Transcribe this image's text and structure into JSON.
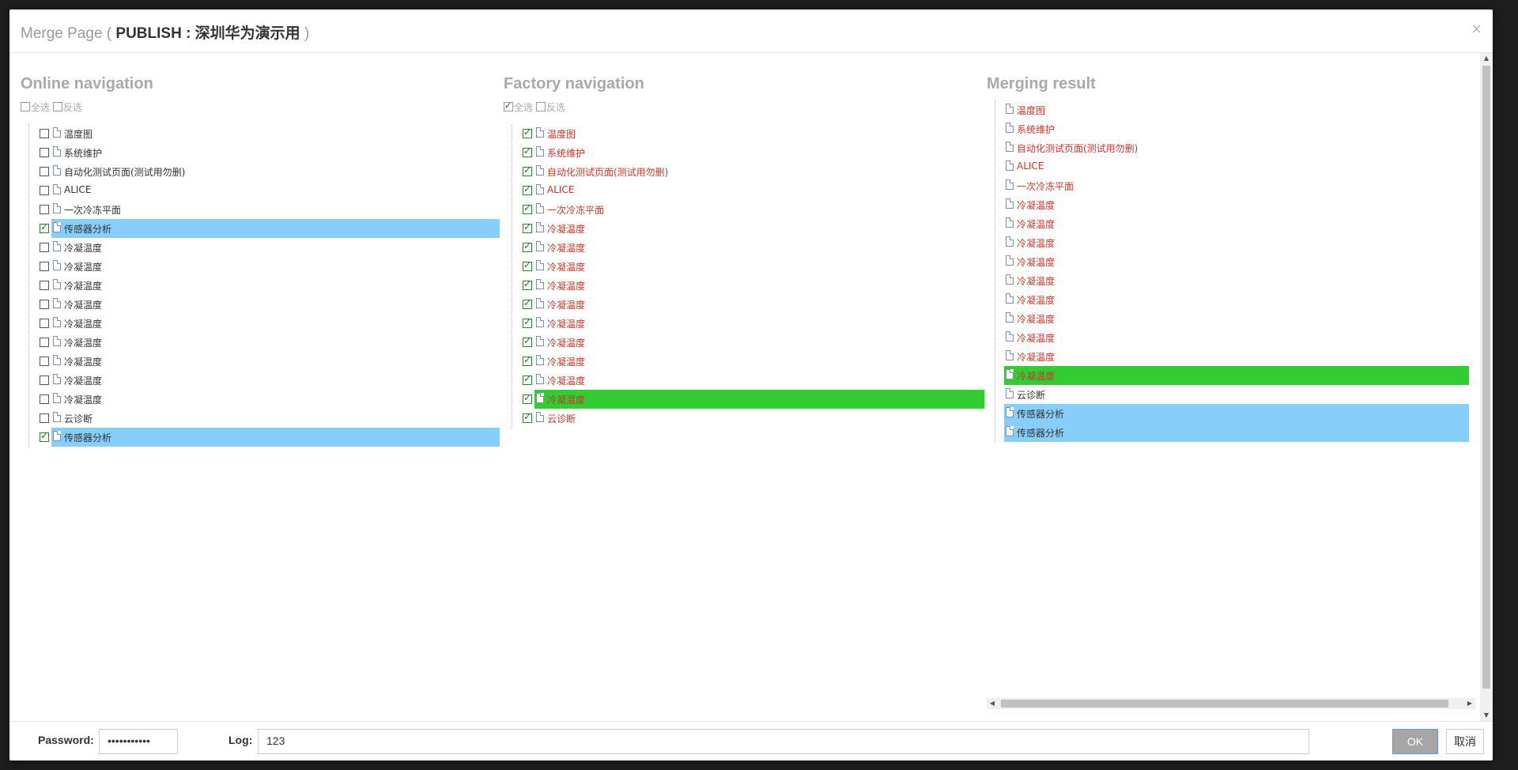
{
  "dialog": {
    "title_prefix": "Merge Page ( ",
    "title_bold": "PUBLISH : 深圳华为演示用",
    "title_suffix": " )",
    "close": "×"
  },
  "online": {
    "heading": "Online navigation",
    "select_all": "全选",
    "invert": "反选",
    "select_all_checked": false,
    "invert_checked": false,
    "items": [
      {
        "label": "温度图",
        "checked": false,
        "highlight": ""
      },
      {
        "label": "系统维护",
        "checked": false,
        "highlight": ""
      },
      {
        "label": "自动化测试页面(测试用勿删)",
        "checked": false,
        "highlight": ""
      },
      {
        "label": "ALICE",
        "checked": false,
        "highlight": ""
      },
      {
        "label": "一次冷冻平面",
        "checked": false,
        "highlight": ""
      },
      {
        "label": "传感器分析",
        "checked": true,
        "highlight": "blue"
      },
      {
        "label": "冷凝温度",
        "checked": false,
        "highlight": ""
      },
      {
        "label": "冷凝温度",
        "checked": false,
        "highlight": ""
      },
      {
        "label": "冷凝温度",
        "checked": false,
        "highlight": ""
      },
      {
        "label": "冷凝温度",
        "checked": false,
        "highlight": ""
      },
      {
        "label": "冷凝温度",
        "checked": false,
        "highlight": ""
      },
      {
        "label": "冷凝温度",
        "checked": false,
        "highlight": ""
      },
      {
        "label": "冷凝温度",
        "checked": false,
        "highlight": ""
      },
      {
        "label": "冷凝温度",
        "checked": false,
        "highlight": ""
      },
      {
        "label": "冷凝温度",
        "checked": false,
        "highlight": ""
      },
      {
        "label": "云诊断",
        "checked": false,
        "highlight": ""
      },
      {
        "label": "传感器分析",
        "checked": true,
        "highlight": "blue"
      }
    ]
  },
  "factory": {
    "heading": "Factory navigation",
    "select_all": "全选",
    "invert": "反选",
    "select_all_checked": true,
    "invert_checked": false,
    "items": [
      {
        "label": "温度图",
        "checked": true,
        "highlight": ""
      },
      {
        "label": "系统维护",
        "checked": true,
        "highlight": ""
      },
      {
        "label": "自动化测试页面(测试用勿删)",
        "checked": true,
        "highlight": ""
      },
      {
        "label": "ALICE",
        "checked": true,
        "highlight": ""
      },
      {
        "label": "一次冷冻平面",
        "checked": true,
        "highlight": ""
      },
      {
        "label": "冷凝温度",
        "checked": true,
        "highlight": ""
      },
      {
        "label": "冷凝温度",
        "checked": true,
        "highlight": ""
      },
      {
        "label": "冷凝温度",
        "checked": true,
        "highlight": ""
      },
      {
        "label": "冷凝温度",
        "checked": true,
        "highlight": ""
      },
      {
        "label": "冷凝温度",
        "checked": true,
        "highlight": ""
      },
      {
        "label": "冷凝温度",
        "checked": true,
        "highlight": ""
      },
      {
        "label": "冷凝温度",
        "checked": true,
        "highlight": ""
      },
      {
        "label": "冷凝温度",
        "checked": true,
        "highlight": ""
      },
      {
        "label": "冷凝温度",
        "checked": true,
        "highlight": ""
      },
      {
        "label": "冷凝温度",
        "checked": true,
        "highlight": "green"
      },
      {
        "label": "云诊断",
        "checked": true,
        "highlight": ""
      }
    ]
  },
  "result": {
    "heading": "Merging result",
    "items": [
      {
        "label": "温度图",
        "highlight": ""
      },
      {
        "label": "系统维护",
        "highlight": ""
      },
      {
        "label": "自动化测试页面(测试用勿删)",
        "highlight": ""
      },
      {
        "label": "ALICE",
        "highlight": ""
      },
      {
        "label": "一次冷冻平面",
        "highlight": ""
      },
      {
        "label": "冷凝温度",
        "highlight": ""
      },
      {
        "label": "冷凝温度",
        "highlight": ""
      },
      {
        "label": "冷凝温度",
        "highlight": ""
      },
      {
        "label": "冷凝温度",
        "highlight": ""
      },
      {
        "label": "冷凝温度",
        "highlight": ""
      },
      {
        "label": "冷凝温度",
        "highlight": ""
      },
      {
        "label": "冷凝温度",
        "highlight": ""
      },
      {
        "label": "冷凝温度",
        "highlight": ""
      },
      {
        "label": "冷凝温度",
        "highlight": ""
      },
      {
        "label": "冷凝温度",
        "highlight": "green"
      },
      {
        "label": "云诊断",
        "highlight": ""
      },
      {
        "label": "传感器分析",
        "highlight": "blue"
      },
      {
        "label": "传感器分析",
        "highlight": "blue"
      }
    ]
  },
  "footer": {
    "password_label": "Password:",
    "password_value": "•••••••••••",
    "log_label": "Log:",
    "log_value": "123",
    "ok_label": "OK",
    "cancel_label": "取消"
  },
  "colors": {
    "highlight_blue": "#87cefa",
    "highlight_green": "#33cc33",
    "new_item_red": "#c0392b"
  }
}
